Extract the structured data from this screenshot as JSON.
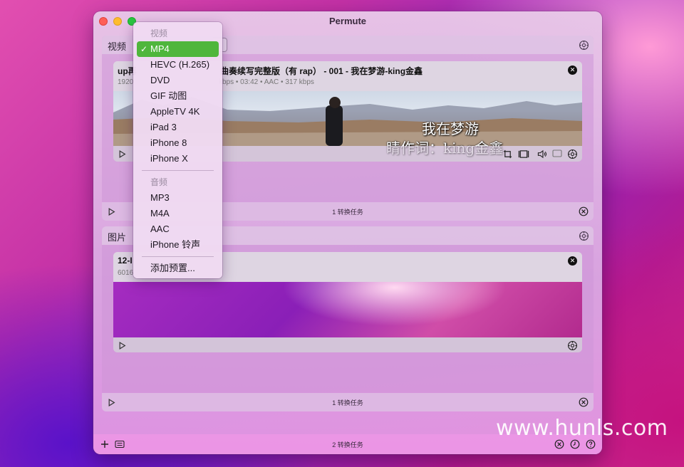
{
  "window": {
    "title": "Permute"
  },
  "video_section": {
    "label": "视频",
    "card": {
      "title": "up再奏续写完整版（有 rap） - 001 - 我在梦游-king金鑫",
      "title_prefix": "up再",
      "title_suffix": "曲奏续写完整版（有 rap） - 001 - 我在梦游-king金鑫",
      "meta_prefix": "1920",
      "meta_suffix": "kbps • 03:42 • AAC • 317 kbps",
      "subtitle_line1": "我在梦游",
      "subtitle_line2": "睛作词：king金鑫"
    },
    "footer": "1 转换任务"
  },
  "image_section": {
    "label": "图片",
    "card": {
      "title_prefix": "12-I",
      "meta_prefix": "6016"
    },
    "footer": "1 转换任务"
  },
  "bottom_bar": {
    "status": "2 转换任务"
  },
  "format_menu": {
    "video_header": "视频",
    "video_items": [
      "MP4",
      "HEVC (H.265)",
      "DVD",
      "GIF 动图",
      "AppleTV 4K",
      "iPad 3",
      "iPhone 8",
      "iPhone X"
    ],
    "selected": "MP4",
    "audio_header": "音频",
    "audio_items": [
      "MP3",
      "M4A",
      "AAC",
      "iPhone 铃声"
    ],
    "add_preset": "添加预置..."
  },
  "watermark": "www.hunls.com",
  "colors": {
    "selected_item": "#4fb63c",
    "close_dot": "#111111"
  }
}
